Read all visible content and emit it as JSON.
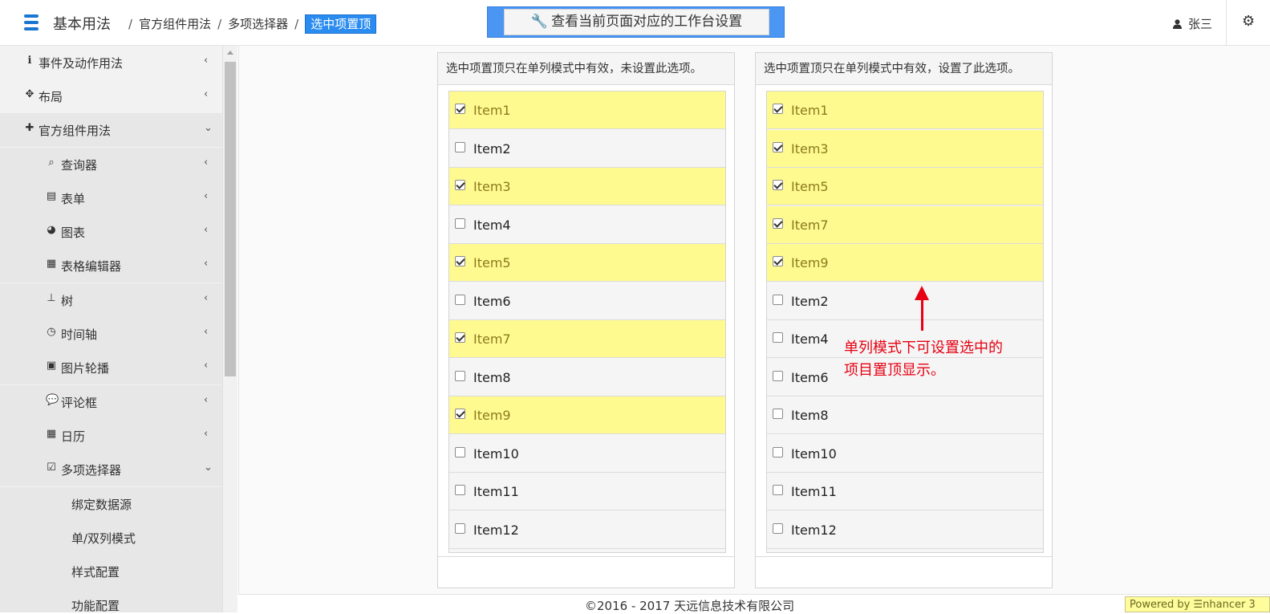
{
  "header": {
    "brand": "基本用法",
    "breadcrumb": [
      "官方组件用法",
      "多项选择器",
      "选中项置顶"
    ],
    "workspace_button": "查看当前页面对应的工作台设置",
    "user_name": "张三"
  },
  "sidebar": {
    "items": [
      {
        "label": "事件及动作用法",
        "icon": "info-icon",
        "chevron": "‹"
      },
      {
        "label": "布局",
        "icon": "move-icon",
        "chevron": "‹"
      },
      {
        "label": "官方组件用法",
        "icon": "puzzle-icon",
        "chevron": "⌄"
      },
      {
        "label": "查询器",
        "icon": "search-icon",
        "chevron": "‹"
      },
      {
        "label": "表单",
        "icon": "form-icon",
        "chevron": "‹"
      },
      {
        "label": "图表",
        "icon": "pie-chart-icon",
        "chevron": "‹"
      },
      {
        "label": "表格编辑器",
        "icon": "table-icon",
        "chevron": "‹"
      },
      {
        "label": "树",
        "icon": "sitemap-icon",
        "chevron": "‹"
      },
      {
        "label": "时间轴",
        "icon": "clock-icon",
        "chevron": "‹"
      },
      {
        "label": "图片轮播",
        "icon": "image-icon",
        "chevron": "‹"
      },
      {
        "label": "评论框",
        "icon": "comment-icon",
        "chevron": "‹"
      },
      {
        "label": "日历",
        "icon": "calendar-icon",
        "chevron": "‹"
      },
      {
        "label": "多项选择器",
        "icon": "checkbox-icon",
        "chevron": "⌄"
      },
      {
        "label": "绑定数据源"
      },
      {
        "label": "单/双列模式"
      },
      {
        "label": "样式配置"
      },
      {
        "label": "功能配置"
      }
    ]
  },
  "panels": {
    "left": {
      "title": "选中项置顶只在单列模式中有效，未设置此选项。",
      "items": [
        {
          "label": "Item1",
          "checked": true
        },
        {
          "label": "Item2",
          "checked": false
        },
        {
          "label": "Item3",
          "checked": true
        },
        {
          "label": "Item4",
          "checked": false
        },
        {
          "label": "Item5",
          "checked": true
        },
        {
          "label": "Item6",
          "checked": false
        },
        {
          "label": "Item7",
          "checked": true
        },
        {
          "label": "Item8",
          "checked": false
        },
        {
          "label": "Item9",
          "checked": true
        },
        {
          "label": "Item10",
          "checked": false
        },
        {
          "label": "Item11",
          "checked": false
        },
        {
          "label": "Item12",
          "checked": false
        }
      ]
    },
    "right": {
      "title": "选中项置顶只在单列模式中有效，设置了此选项。",
      "items": [
        {
          "label": "Item1",
          "checked": true
        },
        {
          "label": "Item3",
          "checked": true
        },
        {
          "label": "Item5",
          "checked": true
        },
        {
          "label": "Item7",
          "checked": true
        },
        {
          "label": "Item9",
          "checked": true
        },
        {
          "label": "Item2",
          "checked": false
        },
        {
          "label": "Item4",
          "checked": false
        },
        {
          "label": "Item6",
          "checked": false
        },
        {
          "label": "Item8",
          "checked": false
        },
        {
          "label": "Item10",
          "checked": false
        },
        {
          "label": "Item11",
          "checked": false
        },
        {
          "label": "Item12",
          "checked": false
        }
      ]
    }
  },
  "annotation": {
    "line1": "单列模式下可设置选中的",
    "line2": "项目置顶显示。"
  },
  "footer": {
    "copyright": "©2016 - 2017 天远信息技术有限公司",
    "powered": "Powered by ☰nhancer 3"
  },
  "colors": {
    "accent": "#2a8cf0",
    "selected_row": "#fffa90",
    "annotation": "#e60012"
  }
}
